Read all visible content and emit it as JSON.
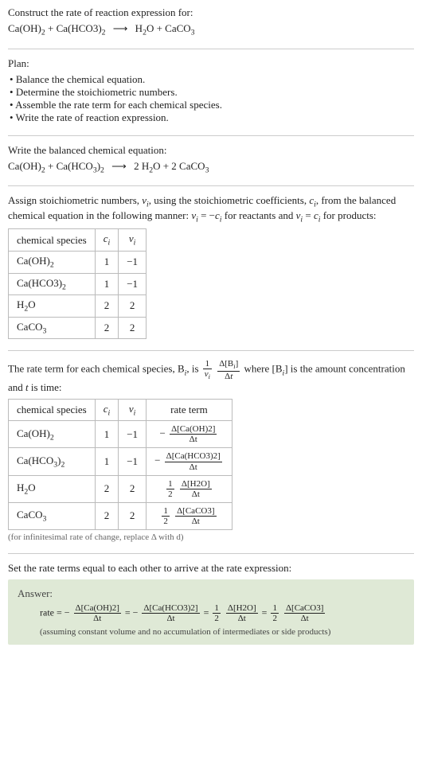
{
  "prompt": {
    "title": "Construct the rate of reaction expression for:",
    "equation": "Ca(OH)₂ + Ca(HCO3)₂  ⟶  H₂O + CaCO₃"
  },
  "plan": {
    "label": "Plan:",
    "items": [
      "Balance the chemical equation.",
      "Determine the stoichiometric numbers.",
      "Assemble the rate term for each chemical species.",
      "Write the rate of reaction expression."
    ]
  },
  "balanced": {
    "label": "Write the balanced chemical equation:",
    "equation": "Ca(OH)₂ + Ca(HCO₃)₂  ⟶  2 H₂O + 2 CaCO₃"
  },
  "assign": {
    "text": "Assign stoichiometric numbers, νᵢ, using the stoichiometric coefficients, cᵢ, from the balanced chemical equation in the following manner: νᵢ = −cᵢ for reactants and νᵢ = cᵢ for products:"
  },
  "table1": {
    "headers": [
      "chemical species",
      "cᵢ",
      "νᵢ"
    ],
    "rows": [
      [
        "Ca(OH)₂",
        "1",
        "−1"
      ],
      [
        "Ca(HCO3)₂",
        "1",
        "−1"
      ],
      [
        "H₂O",
        "2",
        "2"
      ],
      [
        "CaCO₃",
        "2",
        "2"
      ]
    ]
  },
  "rateterm": {
    "pre": "The rate term for each chemical species, Bᵢ, is ",
    "post": " where [Bᵢ] is the amount concentration and t is time:"
  },
  "table2": {
    "headers": [
      "chemical species",
      "cᵢ",
      "νᵢ",
      "rate term"
    ],
    "rows": [
      {
        "sp": "Ca(OH)₂",
        "c": "1",
        "v": "−1",
        "rate_prefix": "−",
        "rate_num": "Δ[Ca(OH)2]",
        "rate_den": "Δt",
        "half": false
      },
      {
        "sp": "Ca(HCO₃)₂",
        "c": "1",
        "v": "−1",
        "rate_prefix": "−",
        "rate_num": "Δ[Ca(HCO3)2]",
        "rate_den": "Δt",
        "half": false
      },
      {
        "sp": "H₂O",
        "c": "2",
        "v": "2",
        "rate_prefix": "",
        "rate_num": "Δ[H2O]",
        "rate_den": "Δt",
        "half": true
      },
      {
        "sp": "CaCO₃",
        "c": "2",
        "v": "2",
        "rate_prefix": "",
        "rate_num": "Δ[CaCO3]",
        "rate_den": "Δt",
        "half": true
      }
    ]
  },
  "infinitesimal_note": "(for infinitesimal rate of change, replace Δ with d)",
  "final_label": "Set the rate terms equal to each other to arrive at the rate expression:",
  "answer": {
    "label": "Answer:",
    "terms": {
      "lhs": "rate",
      "t1_num": "Δ[Ca(OH)2]",
      "t1_den": "Δt",
      "t2_num": "Δ[Ca(HCO3)2]",
      "t2_den": "Δt",
      "t3_num": "Δ[H2O]",
      "t3_den": "Δt",
      "t4_num": "Δ[CaCO3]",
      "t4_den": "Δt"
    },
    "note": "(assuming constant volume and no accumulation of intermediates or side products)"
  },
  "chart_data": {
    "type": "table",
    "title": "Stoichiometric numbers and rate terms",
    "tables": [
      {
        "columns": [
          "chemical species",
          "c_i",
          "nu_i"
        ],
        "rows": [
          [
            "Ca(OH)2",
            1,
            -1
          ],
          [
            "Ca(HCO3)2",
            1,
            -1
          ],
          [
            "H2O",
            2,
            2
          ],
          [
            "CaCO3",
            2,
            2
          ]
        ]
      },
      {
        "columns": [
          "chemical species",
          "c_i",
          "nu_i",
          "rate term"
        ],
        "rows": [
          [
            "Ca(OH)2",
            1,
            -1,
            "-Δ[Ca(OH)2]/Δt"
          ],
          [
            "Ca(HCO3)2",
            1,
            -1,
            "-Δ[Ca(HCO3)2]/Δt"
          ],
          [
            "H2O",
            2,
            2,
            "(1/2) Δ[H2O]/Δt"
          ],
          [
            "CaCO3",
            2,
            2,
            "(1/2) Δ[CaCO3]/Δt"
          ]
        ]
      }
    ],
    "rate_expression": "rate = -Δ[Ca(OH)2]/Δt = -Δ[Ca(HCO3)2]/Δt = (1/2)Δ[H2O]/Δt = (1/2)Δ[CaCO3]/Δt"
  }
}
